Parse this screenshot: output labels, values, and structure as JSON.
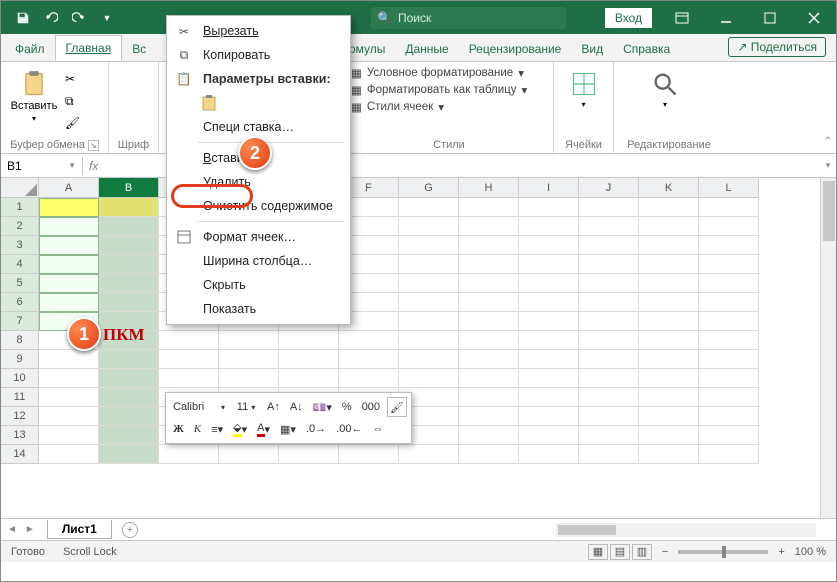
{
  "titlebar": {
    "search_placeholder": "Поиск",
    "signin": "Вход"
  },
  "tabs": {
    "file": "Файл",
    "home": "Главная",
    "insert_partial": "Вс",
    "formulas_partial": "ормулы",
    "data": "Данные",
    "review": "Рецензирование",
    "view": "Вид",
    "help": "Справка",
    "share": "Поделиться"
  },
  "ribbon": {
    "clipboard": {
      "paste": "Вставить",
      "label": "Буфер обмена"
    },
    "font": {
      "label_partial": "Шриф"
    },
    "styles": {
      "cond_fmt": "Условное форматирование",
      "fmt_table": "Форматировать как таблицу",
      "cell_styles": "Стили ячеек",
      "label": "Стили"
    },
    "cells": {
      "label": "Ячейки"
    },
    "editing": {
      "label": "Редактирование"
    }
  },
  "namebox": "B1",
  "columns": [
    "A",
    "B",
    "",
    "",
    "",
    "F",
    "G",
    "H",
    "I",
    "J",
    "K",
    "L"
  ],
  "rows": [
    "1",
    "2",
    "3",
    "4",
    "5",
    "6",
    "7",
    "8",
    "9",
    "10",
    "11",
    "12",
    "13",
    "14"
  ],
  "pkm_label": "ПКМ",
  "sheet_tab": "Лист1",
  "status": {
    "ready": "Готово",
    "scroll": "Scroll Lock",
    "zoom": "100 %"
  },
  "context_menu": {
    "cut": "Вырезать",
    "copy": "Копировать",
    "paste_header": "Параметры вставки:",
    "paste_special_partial": "Специ               ставка…",
    "insert": "Вставить",
    "delete": "Удалить",
    "clear": "Очистить содержимое",
    "format_cells": "Формат ячеек…",
    "col_width": "Ширина столбца…",
    "hide": "Скрыть",
    "show": "Показать"
  },
  "mini_toolbar": {
    "font": "Calibri",
    "size": "11",
    "bold": "Ж",
    "italic": "К"
  },
  "callouts": {
    "one": "1",
    "two": "2"
  }
}
